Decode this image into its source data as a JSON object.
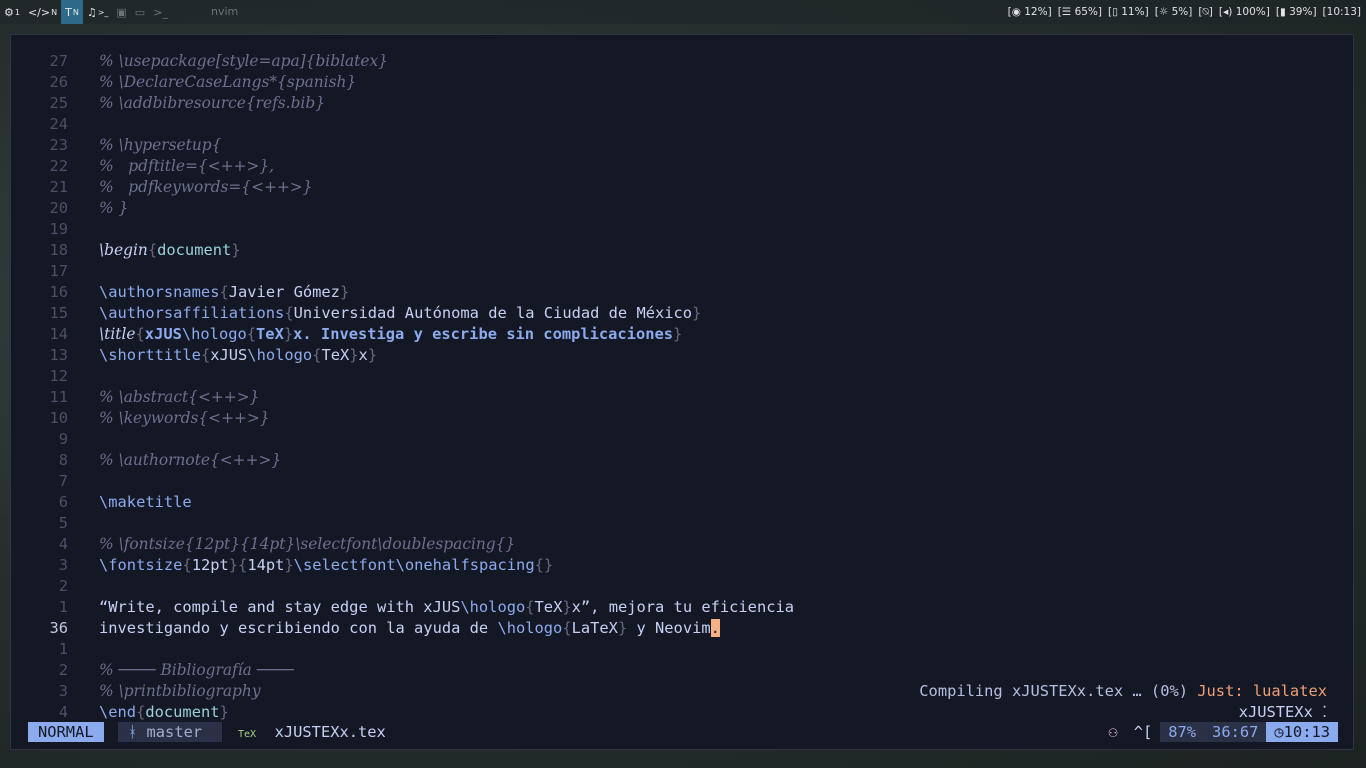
{
  "topbar": {
    "workspaces": [
      {
        "label": "1",
        "icon": "bug-icon",
        "glyph": "⚙"
      },
      {
        "label": "N",
        "icon": "code-icon",
        "glyph": "</>"
      },
      {
        "label": "N",
        "icon": "tex-icon",
        "glyph": "T"
      },
      {
        "label": ">_",
        "icon": "music-icon",
        "glyph": "♫"
      },
      {
        "label": "",
        "icon": "box-icon",
        "glyph": "▣"
      },
      {
        "label": "",
        "icon": "window-icon",
        "glyph": "▭"
      },
      {
        "label": "",
        "icon": "terminal-icon",
        "glyph": ">_"
      }
    ],
    "window_title": "nvim",
    "status": {
      "cpu": "12%",
      "memory": "65%",
      "disk": "11%",
      "brightness": "5%",
      "mic": "",
      "volume": "100%",
      "battery": "39%",
      "time": "[10:13]"
    }
  },
  "editor": {
    "lines": [
      {
        "num": "27",
        "segs": [
          [
            "cm",
            "% \\usepackage[style=apa]{biblatex}"
          ]
        ]
      },
      {
        "num": "26",
        "segs": [
          [
            "cm",
            "% \\DeclareCaseLangs*{spanish}"
          ]
        ]
      },
      {
        "num": "25",
        "segs": [
          [
            "cm",
            "% \\addbibresource{refs.bib}"
          ]
        ]
      },
      {
        "num": "24",
        "segs": []
      },
      {
        "num": "23",
        "segs": [
          [
            "cm",
            "% \\hypersetup{"
          ]
        ]
      },
      {
        "num": "22",
        "segs": [
          [
            "cm",
            "%   pdftitle={<++>},"
          ]
        ]
      },
      {
        "num": "21",
        "segs": [
          [
            "cm",
            "%   pdfkeywords={<++>}"
          ]
        ]
      },
      {
        "num": "20",
        "segs": [
          [
            "cm",
            "% }"
          ]
        ]
      },
      {
        "num": "19",
        "segs": []
      },
      {
        "num": "18",
        "segs": [
          [
            "cmdi",
            "\\begin"
          ],
          [
            "br",
            "{"
          ],
          [
            "arg",
            "document"
          ],
          [
            "br",
            "}"
          ]
        ]
      },
      {
        "num": "17",
        "segs": []
      },
      {
        "num": "16",
        "segs": [
          [
            "cmd",
            "\\authorsnames"
          ],
          [
            "br",
            "{"
          ],
          [
            "txt",
            "Javier Gómez"
          ],
          [
            "br",
            "}"
          ]
        ]
      },
      {
        "num": "15",
        "segs": [
          [
            "cmd",
            "\\authorsaffiliations"
          ],
          [
            "br",
            "{"
          ],
          [
            "txt",
            "Universidad Autónoma de la Ciudad de México"
          ],
          [
            "br",
            "}"
          ]
        ]
      },
      {
        "num": "14",
        "segs": [
          [
            "cmdi",
            "\\title"
          ],
          [
            "br",
            "{"
          ],
          [
            "bold",
            "xJUS"
          ],
          [
            "cmd",
            "\\hologo"
          ],
          [
            "br",
            "{"
          ],
          [
            "bold",
            "TeX"
          ],
          [
            "br",
            "}"
          ],
          [
            "bold",
            "x. Investiga y escribe sin complicaciones"
          ],
          [
            "br",
            "}"
          ]
        ]
      },
      {
        "num": "13",
        "segs": [
          [
            "cmd",
            "\\shorttitle"
          ],
          [
            "br",
            "{"
          ],
          [
            "txt",
            "xJUS"
          ],
          [
            "cmd",
            "\\hologo"
          ],
          [
            "br",
            "{"
          ],
          [
            "txt",
            "TeX"
          ],
          [
            "br",
            "}"
          ],
          [
            "txt",
            "x"
          ],
          [
            "br",
            "}"
          ]
        ]
      },
      {
        "num": "12",
        "segs": []
      },
      {
        "num": "11",
        "segs": [
          [
            "cm",
            "% \\abstract{<++>}"
          ]
        ]
      },
      {
        "num": "10",
        "segs": [
          [
            "cm",
            "% \\keywords{<++>}"
          ]
        ]
      },
      {
        "num": "9",
        "segs": []
      },
      {
        "num": "8",
        "segs": [
          [
            "cm",
            "% \\authornote{<++>}"
          ]
        ]
      },
      {
        "num": "7",
        "segs": []
      },
      {
        "num": "6",
        "segs": [
          [
            "cmd",
            "\\maketitle"
          ]
        ]
      },
      {
        "num": "5",
        "segs": []
      },
      {
        "num": "4",
        "segs": [
          [
            "cm",
            "% \\fontsize{12pt}{14pt}\\selectfont\\doublespacing{}"
          ]
        ]
      },
      {
        "num": "3",
        "segs": [
          [
            "cmd",
            "\\fontsize"
          ],
          [
            "br",
            "{"
          ],
          [
            "txt",
            "12pt"
          ],
          [
            "br",
            "}{"
          ],
          [
            "txt",
            "14pt"
          ],
          [
            "br",
            "}"
          ],
          [
            "cmd",
            "\\selectfont\\onehalfspacing"
          ],
          [
            "br",
            "{}"
          ]
        ]
      },
      {
        "num": "2",
        "segs": []
      },
      {
        "num": "1",
        "segs": [
          [
            "txt",
            "“Write, compile and stay edge with xJUS"
          ],
          [
            "cmd",
            "\\hologo"
          ],
          [
            "br",
            "{"
          ],
          [
            "txt",
            "TeX"
          ],
          [
            "br",
            "}"
          ],
          [
            "txt",
            "x”, mejora tu eficiencia"
          ]
        ]
      },
      {
        "num": "36",
        "current": true,
        "segs": [
          [
            "txt",
            "investigando y escribiendo con la ayuda de "
          ],
          [
            "cmd",
            "\\hologo"
          ],
          [
            "br",
            "{"
          ],
          [
            "txt",
            "LaTeX"
          ],
          [
            "br",
            "}"
          ],
          [
            "txt",
            " y Neovim"
          ],
          [
            "cursor",
            "."
          ]
        ]
      },
      {
        "num": "1",
        "segs": []
      },
      {
        "num": "2",
        "segs": [
          [
            "cm",
            "% ──── Bibliografía ────"
          ]
        ]
      },
      {
        "num": "3",
        "segs": [
          [
            "cm",
            "% \\printbibliography"
          ]
        ]
      },
      {
        "num": "4",
        "segs": [
          [
            "cmd",
            "\\end"
          ],
          [
            "br",
            "{"
          ],
          [
            "arg",
            "document"
          ],
          [
            "br",
            "}"
          ]
        ]
      }
    ],
    "notification": {
      "message": "Compiling xJUSTEXx.tex … (0%) ",
      "task": "Just: lualatex"
    },
    "float_filename": "xJUSTEXx ⁚"
  },
  "statusline": {
    "mode": "NORMAL",
    "branch": "master",
    "filename": "xJUSTEXx.tex",
    "file_icon": "TeX",
    "copilot": "⚇",
    "keys": "^[",
    "percent": "87%",
    "position": "36:67",
    "clock": "◷10:13"
  }
}
